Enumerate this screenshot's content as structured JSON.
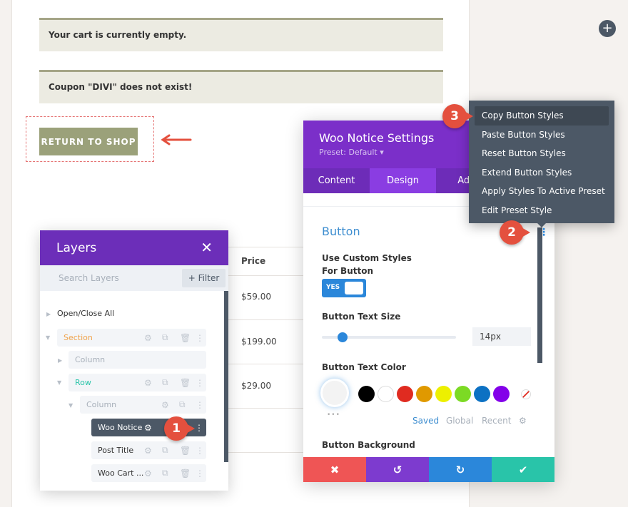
{
  "page": {
    "notice_empty": "Your cart is currently empty.",
    "notice_coupon": "Coupon \"DIVI\" does not exist!",
    "return_button": "RETURN TO SHOP"
  },
  "table": {
    "price_header": "Price",
    "prices": [
      "$59.00",
      "$199.00",
      "$29.00"
    ]
  },
  "layers": {
    "title": "Layers",
    "search_placeholder": "Search Layers",
    "filter_label": "+ Filter",
    "open_close_all": "Open/Close All",
    "items": [
      {
        "label": "Section",
        "color": "#f0a34b"
      },
      {
        "label": "Column"
      },
      {
        "label": "Row",
        "color": "#29c4a9"
      },
      {
        "label": "Column"
      },
      {
        "label": "Woo Notice"
      },
      {
        "label": "Post Title"
      },
      {
        "label": "Woo Cart ..."
      }
    ]
  },
  "settings": {
    "title": "Woo Notice Settings",
    "preset": "Preset: Default ▾",
    "tabs": [
      "Content",
      "Design",
      "Adva"
    ],
    "section": "Button",
    "custom_styles_label": "Use Custom Styles For Button",
    "toggle": "YES",
    "text_size_label": "Button Text Size",
    "text_size_value": "14px",
    "text_size_slider_px": 14,
    "text_color_label": "Button Text Color",
    "swatches": [
      "#000000",
      "#ffffff",
      "#e02b20",
      "#e09900",
      "#edf000",
      "#7cda24",
      "#0c71c3",
      "#8300e9"
    ],
    "color_tabs": [
      "Saved",
      "Global",
      "Recent"
    ],
    "background_label": "Button Background"
  },
  "footer_colors": {
    "cancel": "#ef5555",
    "undo": "#7d3bcf",
    "redo": "#2b87da",
    "save": "#29c4a9"
  },
  "menu": {
    "items": [
      "Copy Button Styles",
      "Paste Button Styles",
      "Reset Button Styles",
      "Extend Button Styles",
      "Apply Styles To Active Preset",
      "Edit Preset Style"
    ]
  },
  "badges": [
    "1",
    "2",
    "3"
  ]
}
